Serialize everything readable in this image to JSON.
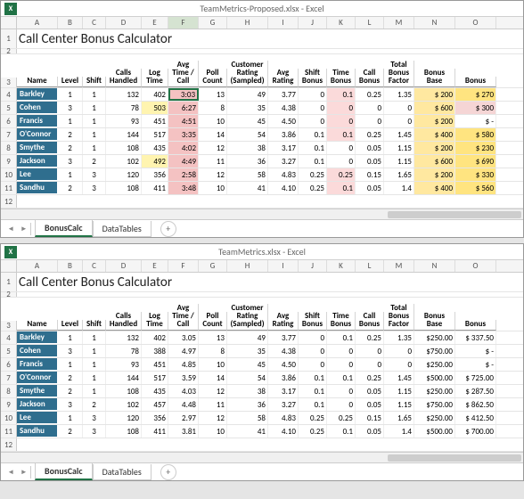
{
  "top": {
    "title": "TeamMetrics-Proposed.xlsx - Excel"
  },
  "bottom": {
    "title": "TeamMetrics.xlsx - Excel"
  },
  "page_title": "Call Center Bonus Calculator",
  "columns": [
    "A",
    "B",
    "C",
    "D",
    "E",
    "F",
    "G",
    "H",
    "I",
    "J",
    "K",
    "L",
    "M",
    "N",
    "O"
  ],
  "widths": [
    "cA",
    "cB",
    "cC",
    "cD",
    "cE",
    "cF",
    "cG",
    "cH",
    "cI",
    "cJ",
    "cK",
    "cL",
    "cM",
    "cN",
    "cO"
  ],
  "headers": [
    "Name",
    "Level",
    "Shift",
    "Calls Handled",
    "Log Time",
    "Avg Time / Call",
    "Poll Count",
    "Customer Rating (Sampled)",
    "Avg Rating",
    "Shift Bonus",
    "Time Bonus",
    "Call Bonus",
    "Total Bonus Factor",
    "Bonus Base",
    "Bonus"
  ],
  "top_rows": [
    {
      "name": "Barkley",
      "lvl": "1",
      "sh": "1",
      "ch": "132",
      "lt": "402",
      "avg": "3:03",
      "pc": "13",
      "cr": "49",
      "ar": "3.77",
      "sb": "0",
      "tb": "0.1",
      "cb": "0.25",
      "tbf": "1.35",
      "bb": "$ 200",
      "bn": "$   270",
      "hl": {
        "lt": "",
        "avg": "hl-time",
        "tb": "hl-pinkcell",
        "bb": "hl-bonus",
        "bn": "hl-bonus-y"
      }
    },
    {
      "name": "Cohen",
      "lvl": "3",
      "sh": "1",
      "ch": "78",
      "lt": "503",
      "avg": "6:27",
      "pc": "8",
      "cr": "35",
      "ar": "4.38",
      "sb": "0",
      "tb": "0",
      "cb": "0",
      "tbf": "0",
      "bb": "$ 600",
      "bn": "$   300",
      "hl": {
        "lt": "hl-log",
        "avg": "hl-time",
        "tb": "hl-pinkcell",
        "bb": "hl-bonus",
        "bn": "hl-pink"
      }
    },
    {
      "name": "Francis",
      "lvl": "1",
      "sh": "1",
      "ch": "93",
      "lt": "451",
      "avg": "4:51",
      "pc": "10",
      "cr": "45",
      "ar": "4.50",
      "sb": "0",
      "tb": "0",
      "cb": "0",
      "tbf": "0",
      "bb": "$ 200",
      "bn": "$     -",
      "hl": {
        "lt": "",
        "avg": "hl-time",
        "tb": "hl-pinkcell",
        "bb": "hl-bonus",
        "bn": ""
      }
    },
    {
      "name": "O'Connor",
      "lvl": "2",
      "sh": "1",
      "ch": "144",
      "lt": "517",
      "avg": "3:35",
      "pc": "14",
      "cr": "54",
      "ar": "3.86",
      "sb": "0.1",
      "tb": "0.1",
      "cb": "0.25",
      "tbf": "1.45",
      "bb": "$ 400",
      "bn": "$   580",
      "hl": {
        "lt": "",
        "avg": "hl-time",
        "tb": "hl-pinkcell",
        "bb": "hl-bonus",
        "bn": "hl-bonus-y"
      }
    },
    {
      "name": "Smythe",
      "lvl": "2",
      "sh": "1",
      "ch": "108",
      "lt": "435",
      "avg": "4:02",
      "pc": "12",
      "cr": "38",
      "ar": "3.17",
      "sb": "0.1",
      "tb": "0",
      "cb": "0.05",
      "tbf": "1.15",
      "bb": "$ 200",
      "bn": "$   230",
      "hl": {
        "lt": "",
        "avg": "hl-time",
        "tb": "",
        "bb": "hl-bonus",
        "bn": "hl-bonus-y"
      }
    },
    {
      "name": "Jackson",
      "lvl": "3",
      "sh": "2",
      "ch": "102",
      "lt": "492",
      "avg": "4:49",
      "pc": "11",
      "cr": "36",
      "ar": "3.27",
      "sb": "0.1",
      "tb": "0",
      "cb": "0.05",
      "tbf": "1.15",
      "bb": "$ 600",
      "bn": "$   690",
      "hl": {
        "lt": "hl-log",
        "avg": "hl-time",
        "tb": "",
        "bb": "hl-bonus",
        "bn": "hl-bonus-y"
      }
    },
    {
      "name": "Lee",
      "lvl": "1",
      "sh": "3",
      "ch": "120",
      "lt": "356",
      "avg": "2:58",
      "pc": "12",
      "cr": "58",
      "ar": "4.83",
      "sb": "0.25",
      "tb": "0.25",
      "cb": "0.15",
      "tbf": "1.65",
      "bb": "$ 200",
      "bn": "$   330",
      "hl": {
        "lt": "",
        "avg": "hl-time",
        "tb": "hl-pinkcell",
        "bb": "hl-bonus",
        "bn": "hl-bonus-y"
      }
    },
    {
      "name": "Sandhu",
      "lvl": "2",
      "sh": "3",
      "ch": "108",
      "lt": "411",
      "avg": "3:48",
      "pc": "10",
      "cr": "41",
      "ar": "4.10",
      "sb": "0.25",
      "tb": "0.1",
      "cb": "0.05",
      "tbf": "1.4",
      "bb": "$ 400",
      "bn": "$   560",
      "hl": {
        "lt": "",
        "avg": "hl-time",
        "tb": "hl-pinkcell",
        "bb": "hl-bonus",
        "bn": "hl-bonus-y"
      }
    }
  ],
  "bottom_rows": [
    {
      "name": "Barkley",
      "lvl": "1",
      "sh": "1",
      "ch": "132",
      "lt": "402",
      "avg": "3.05",
      "pc": "13",
      "cr": "49",
      "ar": "3.77",
      "sb": "0",
      "tb": "0.1",
      "cb": "0.25",
      "tbf": "1.35",
      "bb": "$250.00",
      "bn": "$ 337.50"
    },
    {
      "name": "Cohen",
      "lvl": "3",
      "sh": "1",
      "ch": "78",
      "lt": "388",
      "avg": "4.97",
      "pc": "8",
      "cr": "35",
      "ar": "4.38",
      "sb": "0",
      "tb": "0",
      "cb": "0",
      "tbf": "0",
      "bb": "$750.00",
      "bn": "$     -"
    },
    {
      "name": "Francis",
      "lvl": "1",
      "sh": "1",
      "ch": "93",
      "lt": "451",
      "avg": "4.85",
      "pc": "10",
      "cr": "45",
      "ar": "4.50",
      "sb": "0",
      "tb": "0",
      "cb": "0",
      "tbf": "0",
      "bb": "$250.00",
      "bn": "$     -"
    },
    {
      "name": "O'Connor",
      "lvl": "2",
      "sh": "1",
      "ch": "144",
      "lt": "517",
      "avg": "3.59",
      "pc": "14",
      "cr": "54",
      "ar": "3.86",
      "sb": "0.1",
      "tb": "0.1",
      "cb": "0.25",
      "tbf": "1.45",
      "bb": "$500.00",
      "bn": "$ 725.00"
    },
    {
      "name": "Smythe",
      "lvl": "2",
      "sh": "1",
      "ch": "108",
      "lt": "435",
      "avg": "4.03",
      "pc": "12",
      "cr": "38",
      "ar": "3.17",
      "sb": "0.1",
      "tb": "0",
      "cb": "0.05",
      "tbf": "1.15",
      "bb": "$250.00",
      "bn": "$ 287.50"
    },
    {
      "name": "Jackson",
      "lvl": "3",
      "sh": "2",
      "ch": "102",
      "lt": "457",
      "avg": "4.48",
      "pc": "11",
      "cr": "36",
      "ar": "3.27",
      "sb": "0.1",
      "tb": "0",
      "cb": "0.05",
      "tbf": "1.15",
      "bb": "$750.00",
      "bn": "$ 862.50"
    },
    {
      "name": "Lee",
      "lvl": "1",
      "sh": "3",
      "ch": "120",
      "lt": "356",
      "avg": "2.97",
      "pc": "12",
      "cr": "58",
      "ar": "4.83",
      "sb": "0.25",
      "tb": "0.25",
      "cb": "0.15",
      "tbf": "1.65",
      "bb": "$250.00",
      "bn": "$ 412.50"
    },
    {
      "name": "Sandhu",
      "lvl": "2",
      "sh": "3",
      "ch": "108",
      "lt": "411",
      "avg": "3.81",
      "pc": "10",
      "cr": "41",
      "ar": "4.10",
      "sb": "0.25",
      "tb": "0.1",
      "cb": "0.05",
      "tbf": "1.4",
      "bb": "$500.00",
      "bn": "$ 700.00"
    }
  ],
  "tabs": {
    "active": "BonusCalc",
    "other": "DataTables"
  },
  "excel_glyph": "X"
}
